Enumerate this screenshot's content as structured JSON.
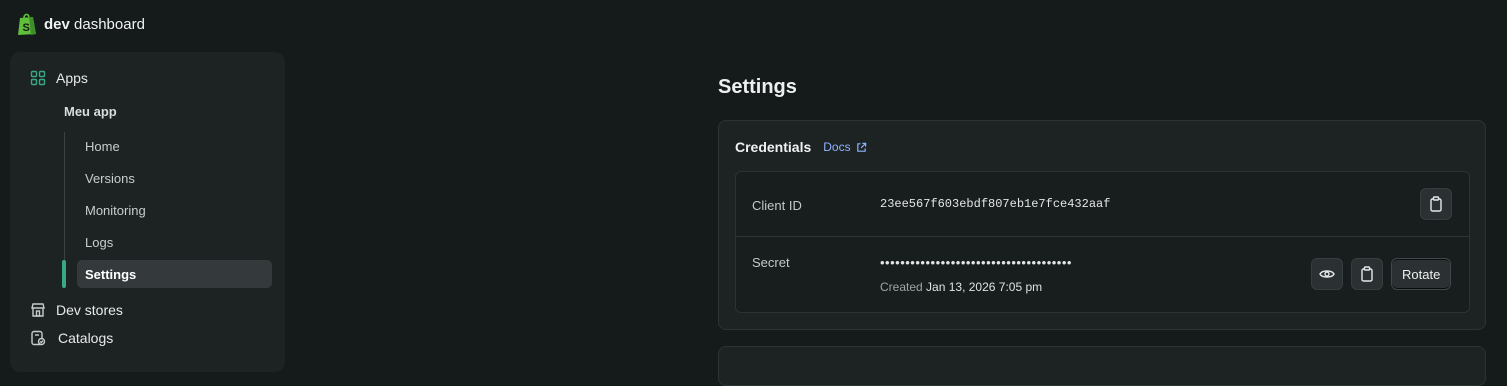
{
  "brand": {
    "bold": "dev",
    "rest": "dashboard"
  },
  "sidebar": {
    "apps_label": "Apps",
    "app_name": "Meu app",
    "sub_items": [
      {
        "label": "Home",
        "active": false
      },
      {
        "label": "Versions",
        "active": false
      },
      {
        "label": "Monitoring",
        "active": false
      },
      {
        "label": "Logs",
        "active": false
      },
      {
        "label": "Settings",
        "active": true
      }
    ],
    "dev_stores_label": "Dev stores",
    "catalogs_label": "Catalogs"
  },
  "main": {
    "title": "Settings",
    "credentials": {
      "title": "Credentials",
      "docs_label": "Docs",
      "client_id_label": "Client ID",
      "client_id_value": "23ee567f603ebdf807eb1e7fce432aaf",
      "secret_label": "Secret",
      "secret_masked": "••••••••••••••••••••••••••••••••••••••",
      "created_prefix": "Created",
      "created_date": "Jan 13, 2026 7:05 pm",
      "rotate_label": "Rotate"
    }
  },
  "colors": {
    "accent": "#3aa885",
    "link": "#8fb4ff",
    "background": "#151a1b"
  },
  "icons": {
    "logo": "shopify-bag-icon",
    "apps": "apps-grid-icon",
    "dev_stores": "store-icon",
    "catalogs": "catalog-icon",
    "external": "external-link-icon",
    "copy": "clipboard-icon",
    "reveal": "eye-icon"
  }
}
